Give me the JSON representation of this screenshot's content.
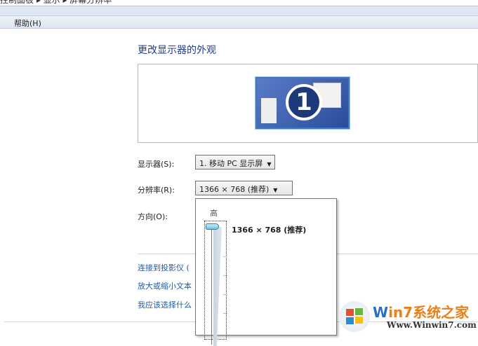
{
  "breadcrumb": "控制面板 ▸ 显示 ▸ 屏幕分辨率",
  "menu": {
    "help": "帮助(H)"
  },
  "title": "更改显示器的外观",
  "monitor_number": "1",
  "display": {
    "label": "显示器(S):",
    "value": "1. 移动 PC 显示屏"
  },
  "resolution": {
    "label": "分辨率(R):",
    "value": "1366 × 768 (推荐)"
  },
  "orientation": {
    "label": "方向(O):"
  },
  "links": [
    "连接到投影仪 (",
    "放大或缩小文本",
    "我应该选择什么"
  ],
  "popup": {
    "high_label": "高",
    "option": "1366 × 768 (推荐)",
    "slider_value_fraction": 1.0
  },
  "watermark": {
    "brand": "Win7系统之家",
    "url": "Www.Winwin7.com"
  }
}
